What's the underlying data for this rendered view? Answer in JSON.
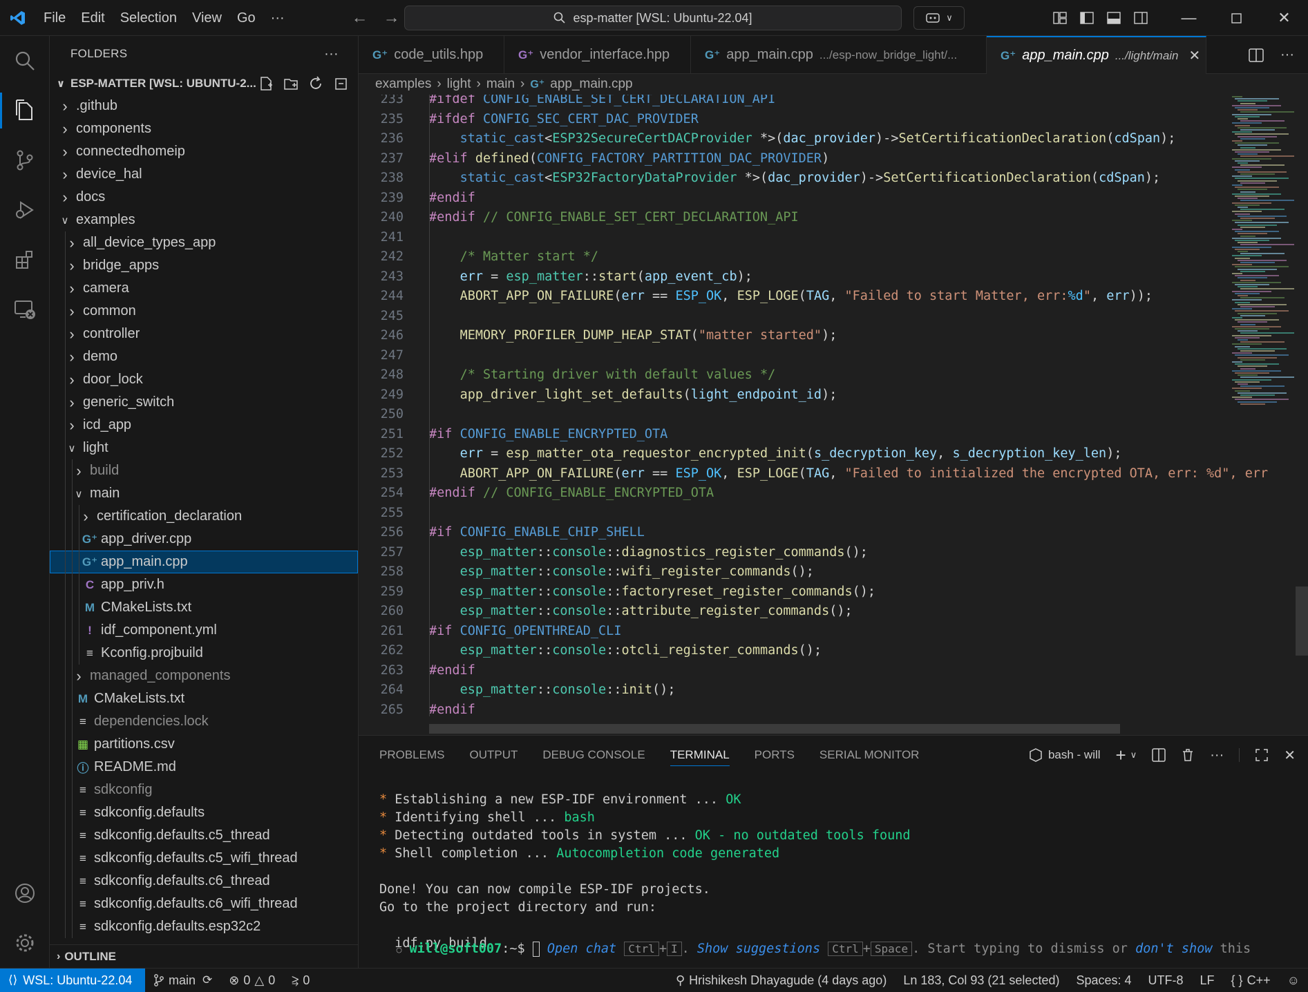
{
  "titlebar": {
    "menu": [
      "File",
      "Edit",
      "Selection",
      "View",
      "Go",
      "···"
    ],
    "search": "esp-matter [WSL: Ubuntu-22.04]"
  },
  "sidebar": {
    "header": "FOLDERS",
    "root": "ESP-MATTER [WSL: UBUNTU-2...",
    "outline": "OUTLINE",
    "tree": [
      {
        "label": ".github",
        "depth": 0,
        "kind": "folder",
        "open": false
      },
      {
        "label": "components",
        "depth": 0,
        "kind": "folder",
        "open": false
      },
      {
        "label": "connectedhomeip",
        "depth": 0,
        "kind": "folder",
        "open": false
      },
      {
        "label": "device_hal",
        "depth": 0,
        "kind": "folder",
        "open": false
      },
      {
        "label": "docs",
        "depth": 0,
        "kind": "folder",
        "open": false
      },
      {
        "label": "examples",
        "depth": 0,
        "kind": "folder",
        "open": true
      },
      {
        "label": "all_device_types_app",
        "depth": 1,
        "kind": "folder",
        "open": false
      },
      {
        "label": "bridge_apps",
        "depth": 1,
        "kind": "folder",
        "open": false
      },
      {
        "label": "camera",
        "depth": 1,
        "kind": "folder",
        "open": false
      },
      {
        "label": "common",
        "depth": 1,
        "kind": "folder",
        "open": false
      },
      {
        "label": "controller",
        "depth": 1,
        "kind": "folder",
        "open": false
      },
      {
        "label": "demo",
        "depth": 1,
        "kind": "folder",
        "open": false
      },
      {
        "label": "door_lock",
        "depth": 1,
        "kind": "folder",
        "open": false
      },
      {
        "label": "generic_switch",
        "depth": 1,
        "kind": "folder",
        "open": false
      },
      {
        "label": "icd_app",
        "depth": 1,
        "kind": "folder",
        "open": false
      },
      {
        "label": "light",
        "depth": 1,
        "kind": "folder",
        "open": true
      },
      {
        "label": "build",
        "depth": 2,
        "kind": "folder",
        "open": false,
        "dim": true
      },
      {
        "label": "main",
        "depth": 2,
        "kind": "folder",
        "open": true
      },
      {
        "label": "certification_declaration",
        "depth": 3,
        "kind": "folder",
        "open": false
      },
      {
        "label": "app_driver.cpp",
        "depth": 3,
        "kind": "cpp"
      },
      {
        "label": "app_main.cpp",
        "depth": 3,
        "kind": "cpp",
        "selected": true
      },
      {
        "label": "app_priv.h",
        "depth": 3,
        "kind": "h"
      },
      {
        "label": "CMakeLists.txt",
        "depth": 3,
        "kind": "cmake"
      },
      {
        "label": "idf_component.yml",
        "depth": 3,
        "kind": "yml"
      },
      {
        "label": "Kconfig.projbuild",
        "depth": 3,
        "kind": "text"
      },
      {
        "label": "managed_components",
        "depth": 2,
        "kind": "folder",
        "open": false,
        "dim": true
      },
      {
        "label": "CMakeLists.txt",
        "depth": 2,
        "kind": "cmake"
      },
      {
        "label": "dependencies.lock",
        "depth": 2,
        "kind": "text",
        "dim": true
      },
      {
        "label": "partitions.csv",
        "depth": 2,
        "kind": "csv"
      },
      {
        "label": "README.md",
        "depth": 2,
        "kind": "info"
      },
      {
        "label": "sdkconfig",
        "depth": 2,
        "kind": "text",
        "dim": true
      },
      {
        "label": "sdkconfig.defaults",
        "depth": 2,
        "kind": "text"
      },
      {
        "label": "sdkconfig.defaults.c5_thread",
        "depth": 2,
        "kind": "text"
      },
      {
        "label": "sdkconfig.defaults.c5_wifi_thread",
        "depth": 2,
        "kind": "text"
      },
      {
        "label": "sdkconfig.defaults.c6_thread",
        "depth": 2,
        "kind": "text"
      },
      {
        "label": "sdkconfig.defaults.c6_wifi_thread",
        "depth": 2,
        "kind": "text"
      },
      {
        "label": "sdkconfig.defaults.esp32c2",
        "depth": 2,
        "kind": "text"
      }
    ]
  },
  "tabs": [
    {
      "label": "code_utils.hpp",
      "desc": ""
    },
    {
      "label": "vendor_interface.hpp",
      "desc": ""
    },
    {
      "label": "app_main.cpp",
      "desc": ".../esp-now_bridge_light/..."
    },
    {
      "label": "app_main.cpp",
      "desc": ".../light/main",
      "active": true
    }
  ],
  "breadcrumb": [
    "examples",
    "light",
    "main",
    "app_main.cpp"
  ],
  "code": [
    {
      "n": "233",
      "t": [
        [
          "k1",
          "#ifdef"
        ],
        [
          "op",
          " "
        ],
        [
          "mac",
          "CONFIG_ENABLE_SET_CERT_DECLARATION_API"
        ]
      ]
    },
    {
      "n": "235",
      "t": [
        [
          "k1",
          "#ifdef"
        ],
        [
          "op",
          " "
        ],
        [
          "mac",
          "CONFIG_SEC_CERT_DAC_PROVIDER"
        ]
      ]
    },
    {
      "n": "236",
      "t": [
        [
          "op",
          "    "
        ],
        [
          "kw2",
          "static_cast"
        ],
        [
          "op",
          "<"
        ],
        [
          "ty",
          "ESP32SecureCertDACProvider"
        ],
        [
          "op",
          " *>("
        ],
        [
          "var",
          "dac_provider"
        ],
        [
          "op",
          ")->"
        ],
        [
          "fn",
          "SetCertificationDeclaration"
        ],
        [
          "op",
          "("
        ],
        [
          "var",
          "cdSpan"
        ],
        [
          "op",
          ");"
        ]
      ]
    },
    {
      "n": "237",
      "t": [
        [
          "k1",
          "#elif"
        ],
        [
          "op",
          " "
        ],
        [
          "fn",
          "defined"
        ],
        [
          "op",
          "("
        ],
        [
          "mac",
          "CONFIG_FACTORY_PARTITION_DAC_PROVIDER"
        ],
        [
          "op",
          ")"
        ]
      ]
    },
    {
      "n": "238",
      "t": [
        [
          "op",
          "    "
        ],
        [
          "kw2",
          "static_cast"
        ],
        [
          "op",
          "<"
        ],
        [
          "ty",
          "ESP32FactoryDataProvider"
        ],
        [
          "op",
          " *>("
        ],
        [
          "var",
          "dac_provider"
        ],
        [
          "op",
          ")->"
        ],
        [
          "fn",
          "SetCertificationDeclaration"
        ],
        [
          "op",
          "("
        ],
        [
          "var",
          "cdSpan"
        ],
        [
          "op",
          ");"
        ]
      ]
    },
    {
      "n": "239",
      "t": [
        [
          "k1",
          "#endif"
        ]
      ]
    },
    {
      "n": "240",
      "t": [
        [
          "k1",
          "#endif"
        ],
        [
          "op",
          " "
        ],
        [
          "cm",
          "// CONFIG_ENABLE_SET_CERT_DECLARATION_API"
        ]
      ]
    },
    {
      "n": "241",
      "t": []
    },
    {
      "n": "242",
      "t": [
        [
          "op",
          "    "
        ],
        [
          "cm",
          "/* Matter start */"
        ]
      ]
    },
    {
      "n": "243",
      "t": [
        [
          "op",
          "    "
        ],
        [
          "var",
          "err"
        ],
        [
          "op",
          " = "
        ],
        [
          "ty",
          "esp_matter"
        ],
        [
          "op",
          "::"
        ],
        [
          "fn",
          "start"
        ],
        [
          "op",
          "("
        ],
        [
          "var",
          "app_event_cb"
        ],
        [
          "op",
          ");"
        ]
      ]
    },
    {
      "n": "244",
      "t": [
        [
          "op",
          "    "
        ],
        [
          "fn",
          "ABORT_APP_ON_FAILURE"
        ],
        [
          "op",
          "("
        ],
        [
          "var",
          "err"
        ],
        [
          "op",
          " == "
        ],
        [
          "cst",
          "ESP_OK"
        ],
        [
          "op",
          ", "
        ],
        [
          "fn",
          "ESP_LOGE"
        ],
        [
          "op",
          "("
        ],
        [
          "var",
          "TAG"
        ],
        [
          "op",
          ", "
        ],
        [
          "str",
          "\"Failed to start Matter, err:"
        ],
        [
          "cst",
          "%d"
        ],
        [
          "str",
          "\""
        ],
        [
          "op",
          ", "
        ],
        [
          "var",
          "err"
        ],
        [
          "op",
          "));"
        ]
      ]
    },
    {
      "n": "245",
      "t": []
    },
    {
      "n": "246",
      "t": [
        [
          "op",
          "    "
        ],
        [
          "fn",
          "MEMORY_PROFILER_DUMP_HEAP_STAT"
        ],
        [
          "op",
          "("
        ],
        [
          "str",
          "\"matter started\""
        ],
        [
          "op",
          ");"
        ]
      ]
    },
    {
      "n": "247",
      "t": []
    },
    {
      "n": "248",
      "t": [
        [
          "op",
          "    "
        ],
        [
          "cm",
          "/* Starting driver with default values */"
        ]
      ]
    },
    {
      "n": "249",
      "t": [
        [
          "op",
          "    "
        ],
        [
          "fn",
          "app_driver_light_set_defaults"
        ],
        [
          "op",
          "("
        ],
        [
          "var",
          "light_endpoint_id"
        ],
        [
          "op",
          ");"
        ]
      ]
    },
    {
      "n": "250",
      "t": []
    },
    {
      "n": "251",
      "t": [
        [
          "k1",
          "#if"
        ],
        [
          "op",
          " "
        ],
        [
          "mac",
          "CONFIG_ENABLE_ENCRYPTED_OTA"
        ]
      ]
    },
    {
      "n": "252",
      "t": [
        [
          "op",
          "    "
        ],
        [
          "var",
          "err"
        ],
        [
          "op",
          " = "
        ],
        [
          "fn",
          "esp_matter_ota_requestor_encrypted_init"
        ],
        [
          "op",
          "("
        ],
        [
          "var",
          "s_decryption_key"
        ],
        [
          "op",
          ", "
        ],
        [
          "var",
          "s_decryption_key_len"
        ],
        [
          "op",
          ");"
        ]
      ]
    },
    {
      "n": "253",
      "t": [
        [
          "op",
          "    "
        ],
        [
          "fn",
          "ABORT_APP_ON_FAILURE"
        ],
        [
          "op",
          "("
        ],
        [
          "var",
          "err"
        ],
        [
          "op",
          " == "
        ],
        [
          "cst",
          "ESP_OK"
        ],
        [
          "op",
          ", "
        ],
        [
          "fn",
          "ESP_LOGE"
        ],
        [
          "op",
          "("
        ],
        [
          "var",
          "TAG"
        ],
        [
          "op",
          ", "
        ],
        [
          "str",
          "\"Failed to initialized the encrypted OTA, err: %d\", err"
        ]
      ]
    },
    {
      "n": "254",
      "t": [
        [
          "k1",
          "#endif"
        ],
        [
          "op",
          " "
        ],
        [
          "cm",
          "// CONFIG_ENABLE_ENCRYPTED_OTA"
        ]
      ]
    },
    {
      "n": "255",
      "t": []
    },
    {
      "n": "256",
      "t": [
        [
          "k1",
          "#if"
        ],
        [
          "op",
          " "
        ],
        [
          "mac",
          "CONFIG_ENABLE_CHIP_SHELL"
        ]
      ]
    },
    {
      "n": "257",
      "t": [
        [
          "op",
          "    "
        ],
        [
          "ty",
          "esp_matter"
        ],
        [
          "op",
          "::"
        ],
        [
          "ty",
          "console"
        ],
        [
          "op",
          "::"
        ],
        [
          "fn",
          "diagnostics_register_commands"
        ],
        [
          "op",
          "();"
        ]
      ]
    },
    {
      "n": "258",
      "t": [
        [
          "op",
          "    "
        ],
        [
          "ty",
          "esp_matter"
        ],
        [
          "op",
          "::"
        ],
        [
          "ty",
          "console"
        ],
        [
          "op",
          "::"
        ],
        [
          "fn",
          "wifi_register_commands"
        ],
        [
          "op",
          "();"
        ]
      ]
    },
    {
      "n": "259",
      "t": [
        [
          "op",
          "    "
        ],
        [
          "ty",
          "esp_matter"
        ],
        [
          "op",
          "::"
        ],
        [
          "ty",
          "console"
        ],
        [
          "op",
          "::"
        ],
        [
          "fn",
          "factoryreset_register_commands"
        ],
        [
          "op",
          "();"
        ]
      ]
    },
    {
      "n": "260",
      "t": [
        [
          "op",
          "    "
        ],
        [
          "ty",
          "esp_matter"
        ],
        [
          "op",
          "::"
        ],
        [
          "ty",
          "console"
        ],
        [
          "op",
          "::"
        ],
        [
          "fn",
          "attribute_register_commands"
        ],
        [
          "op",
          "();"
        ]
      ]
    },
    {
      "n": "261",
      "t": [
        [
          "k1",
          "#if"
        ],
        [
          "op",
          " "
        ],
        [
          "mac",
          "CONFIG_OPENTHREAD_CLI"
        ]
      ]
    },
    {
      "n": "262",
      "t": [
        [
          "op",
          "    "
        ],
        [
          "ty",
          "esp_matter"
        ],
        [
          "op",
          "::"
        ],
        [
          "ty",
          "console"
        ],
        [
          "op",
          "::"
        ],
        [
          "fn",
          "otcli_register_commands"
        ],
        [
          "op",
          "();"
        ]
      ]
    },
    {
      "n": "263",
      "t": [
        [
          "k1",
          "#endif"
        ]
      ]
    },
    {
      "n": "264",
      "t": [
        [
          "op",
          "    "
        ],
        [
          "ty",
          "esp_matter"
        ],
        [
          "op",
          "::"
        ],
        [
          "ty",
          "console"
        ],
        [
          "op",
          "::"
        ],
        [
          "fn",
          "init"
        ],
        [
          "op",
          "();"
        ]
      ]
    },
    {
      "n": "265",
      "t": [
        [
          "k1",
          "#endif"
        ]
      ]
    }
  ],
  "panel": {
    "tabs": [
      "PROBLEMS",
      "OUTPUT",
      "DEBUG CONSOLE",
      "TERMINAL",
      "PORTS",
      "SERIAL MONITOR"
    ],
    "active_tab": "TERMINAL",
    "terminal_name": "bash - will",
    "lines": [
      {
        "star": "*",
        "text": " Establishing a new ESP-IDF environment ... ",
        "ok": "OK"
      },
      {
        "star": "*",
        "text": " Identifying shell ... ",
        "ok": "bash"
      },
      {
        "star": "*",
        "text": " Detecting outdated tools in system ... ",
        "ok": "OK - no outdated tools found"
      },
      {
        "star": "*",
        "text": " Shell completion ... ",
        "ok": "Autocompletion code generated"
      },
      {
        "star": "",
        "text": "",
        "ok": ""
      },
      {
        "star": "",
        "text": "Done! You can now compile ESP-IDF projects.",
        "ok": ""
      },
      {
        "star": "",
        "text": "Go to the project directory and run:",
        "ok": ""
      },
      {
        "star": "",
        "text": "",
        "ok": ""
      },
      {
        "star": "",
        "text": "  idf.py build",
        "ok": ""
      }
    ],
    "prompt": "will@soft007",
    "prompt_path": ":~$",
    "hint_open_chat": "Open chat",
    "hint_key1a": "Ctrl",
    "hint_key1b": "I",
    "hint_show": "Show suggestions",
    "hint_key2a": "Ctrl",
    "hint_key2b": "Space",
    "hint_tail": ". Start typing to dismiss or",
    "hint_dont": "don't show",
    "hint_this": "this"
  },
  "status": {
    "remote": "WSL: Ubuntu-22.04",
    "branch": "main",
    "errors": "0",
    "warnings": "0",
    "ports": "0",
    "blame": "Hrishikesh Dhayagude (4 days ago)",
    "cursor": "Ln 183, Col 93 (21 selected)",
    "spaces": "Spaces: 4",
    "encoding": "UTF-8",
    "eol": "LF",
    "language": "C++"
  },
  "colors": {
    "accent": "#0078d4",
    "selection": "#04395e"
  }
}
